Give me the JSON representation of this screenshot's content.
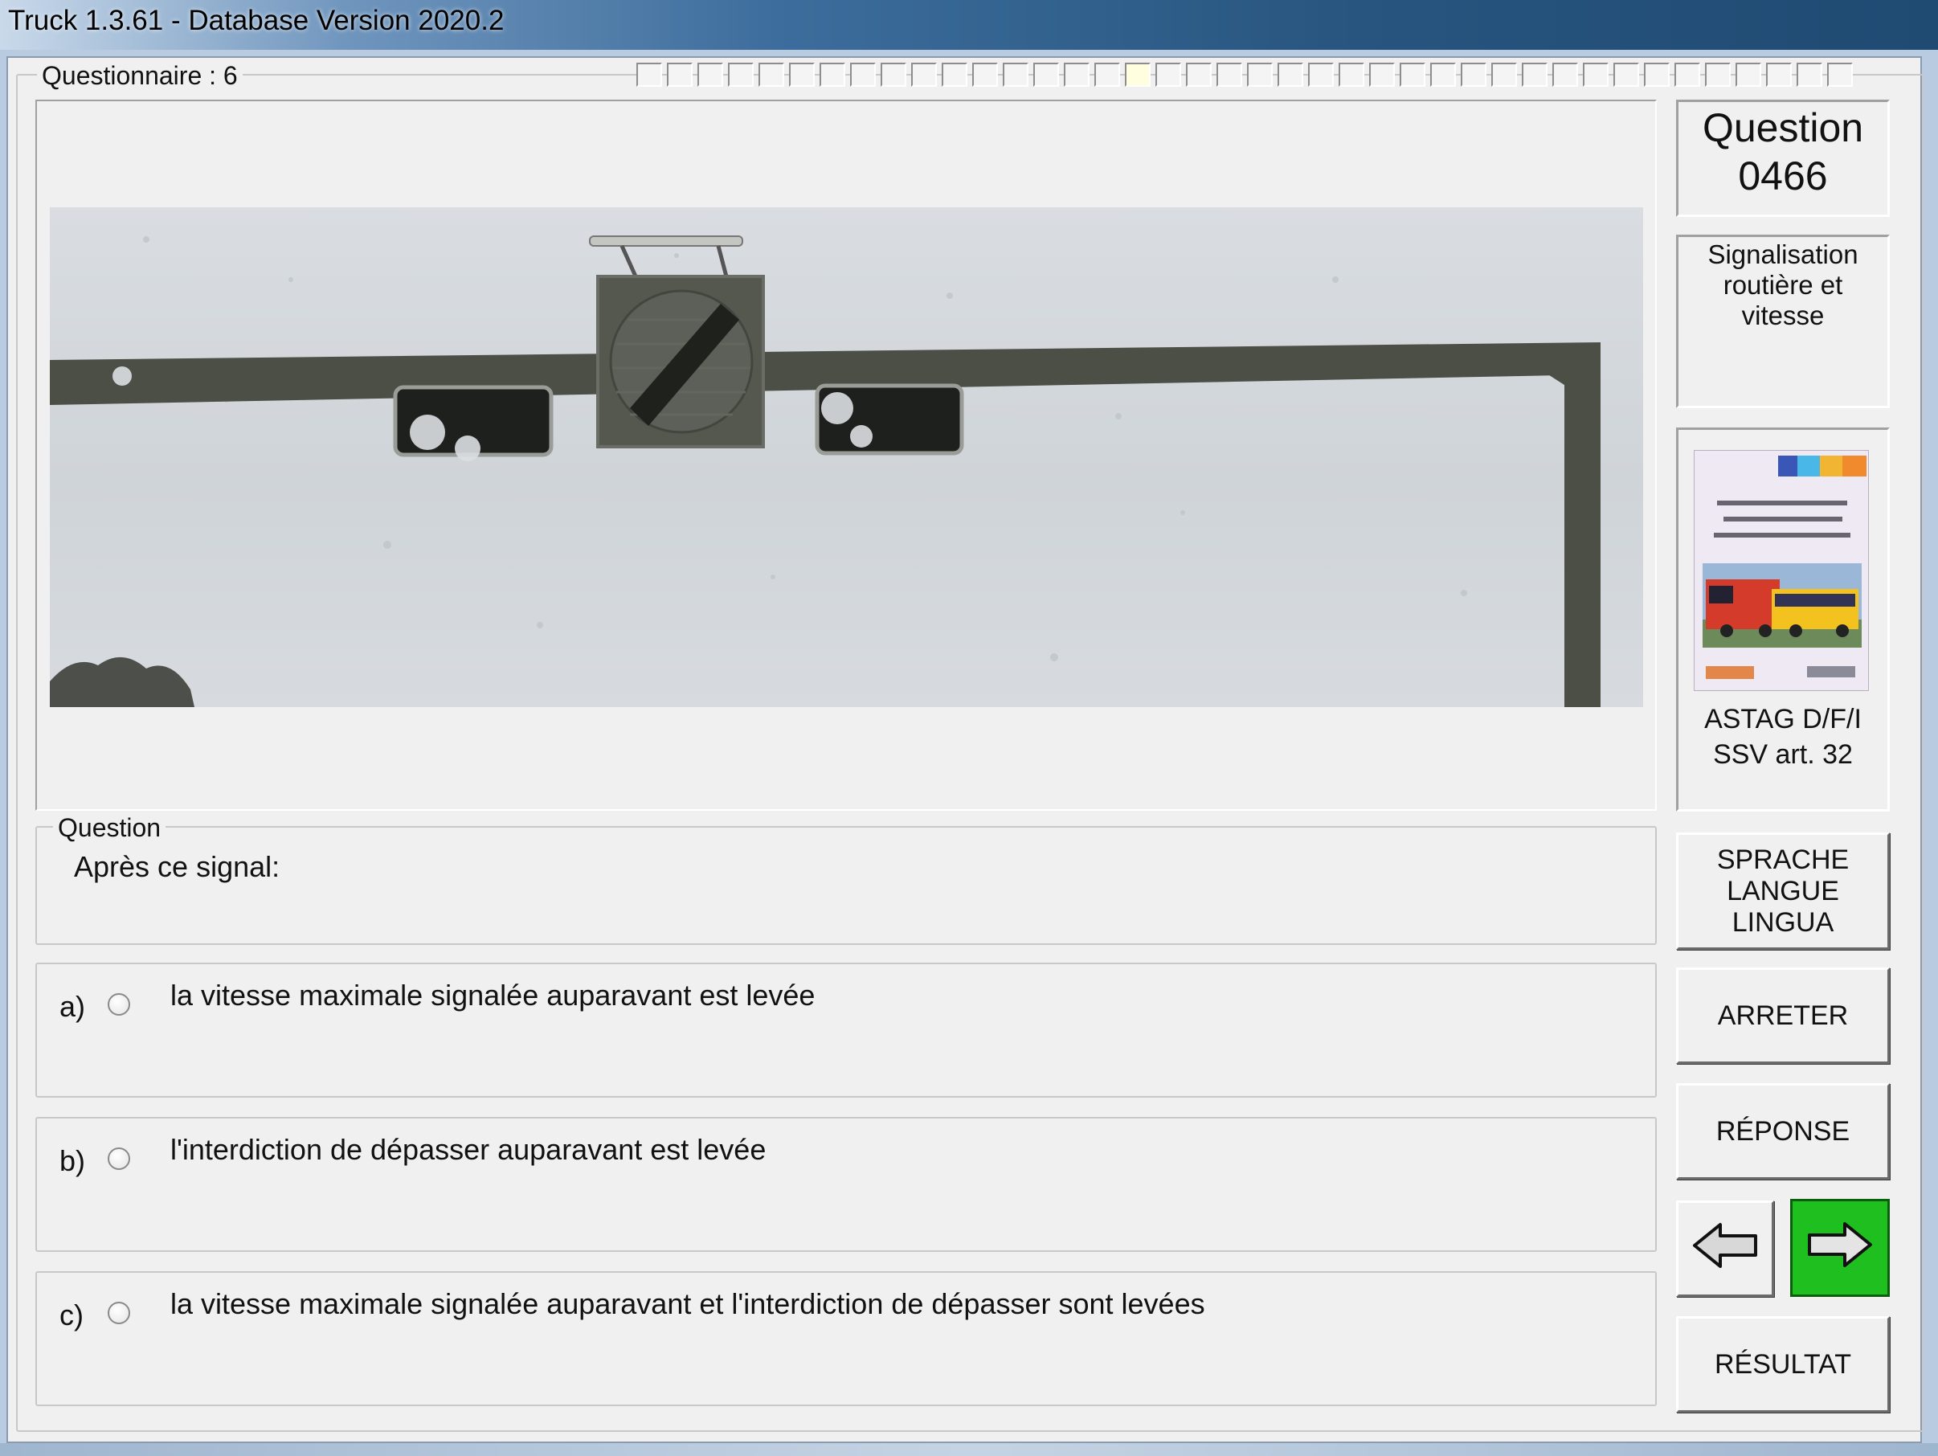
{
  "window": {
    "title": "Truck 1.3.61 - Database Version 2020.2"
  },
  "questionnaire": {
    "label": "Questionnaire : 6",
    "progress": {
      "total": 40,
      "current_index": 16
    }
  },
  "question_info": {
    "title": "Question",
    "number": "0466",
    "category": "Signalisation routière et vitesse",
    "source_line1": "ASTAG D/F/I",
    "source_line2": "SSV art. 32",
    "book_cover": {
      "categories": [
        "C",
        "CE",
        "D",
        "DE"
      ],
      "text": "L'instruction pour le permis de conduire des catégories C, CE et D",
      "publisher_left": "ASTAG",
      "publisher_right": "VOGEL"
    }
  },
  "question": {
    "label": "Question",
    "text": "Après ce signal:"
  },
  "answers": [
    {
      "key": "a)",
      "text": "la vitesse maximale signalée auparavant est levée",
      "selected": false
    },
    {
      "key": "b)",
      "text": "l'interdiction de dépasser auparavant est levée",
      "selected": false
    },
    {
      "key": "c)",
      "text": "la vitesse maximale signalée auparavant et l'interdiction de dépasser sont levées",
      "selected": false
    }
  ],
  "buttons": {
    "language_line1": "SPRACHE",
    "language_line2": "LANGUE",
    "language_line3": "LINGUA",
    "stop": "ARRETER",
    "answer": "RÉPONSE",
    "prev_icon": "arrow-left-icon",
    "next_icon": "arrow-right-icon",
    "result": "RÉSULTAT"
  },
  "colors": {
    "next_button": "#1fbf1f",
    "window_bg": "#f0f0f0",
    "current_progress_cell": "#ffffe0"
  }
}
